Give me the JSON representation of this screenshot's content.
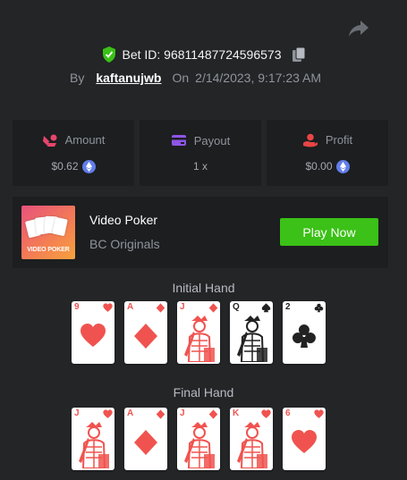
{
  "header": {
    "bet_id": "Bet ID: 96811487724596573",
    "by_label": "By",
    "username": "kaftanujwb",
    "on_label": "On",
    "datetime": "2/14/2023, 9:17:23 AM"
  },
  "stats": [
    {
      "label": "Amount",
      "value": "$0.62",
      "icon": "amount-icon",
      "color": "#e8456b",
      "coin": true
    },
    {
      "label": "Payout",
      "value": "1 x",
      "icon": "payout-icon",
      "color": "#8f54e8",
      "coin": false
    },
    {
      "label": "Profit",
      "value": "$0.00",
      "icon": "profit-icon",
      "color": "#e84545",
      "coin": true
    }
  ],
  "game": {
    "name": "Video Poker",
    "provider": "BC Originals",
    "thumb_label": "VIDEO POKER",
    "play_label": "Play Now"
  },
  "initial_hand": {
    "title": "Initial Hand",
    "cards": [
      {
        "rank": "9",
        "suit": "hearts",
        "face": false
      },
      {
        "rank": "A",
        "suit": "diamonds",
        "face": false
      },
      {
        "rank": "J",
        "suit": "diamonds",
        "face": true
      },
      {
        "rank": "Q",
        "suit": "spades",
        "face": true
      },
      {
        "rank": "2",
        "suit": "clubs",
        "face": false
      }
    ]
  },
  "final_hand": {
    "title": "Final Hand",
    "cards": [
      {
        "rank": "J",
        "suit": "hearts",
        "face": true
      },
      {
        "rank": "A",
        "suit": "diamonds",
        "face": false
      },
      {
        "rank": "J",
        "suit": "diamonds",
        "face": true
      },
      {
        "rank": "K",
        "suit": "hearts",
        "face": true
      },
      {
        "rank": "6",
        "suit": "hearts",
        "face": false
      }
    ]
  }
}
